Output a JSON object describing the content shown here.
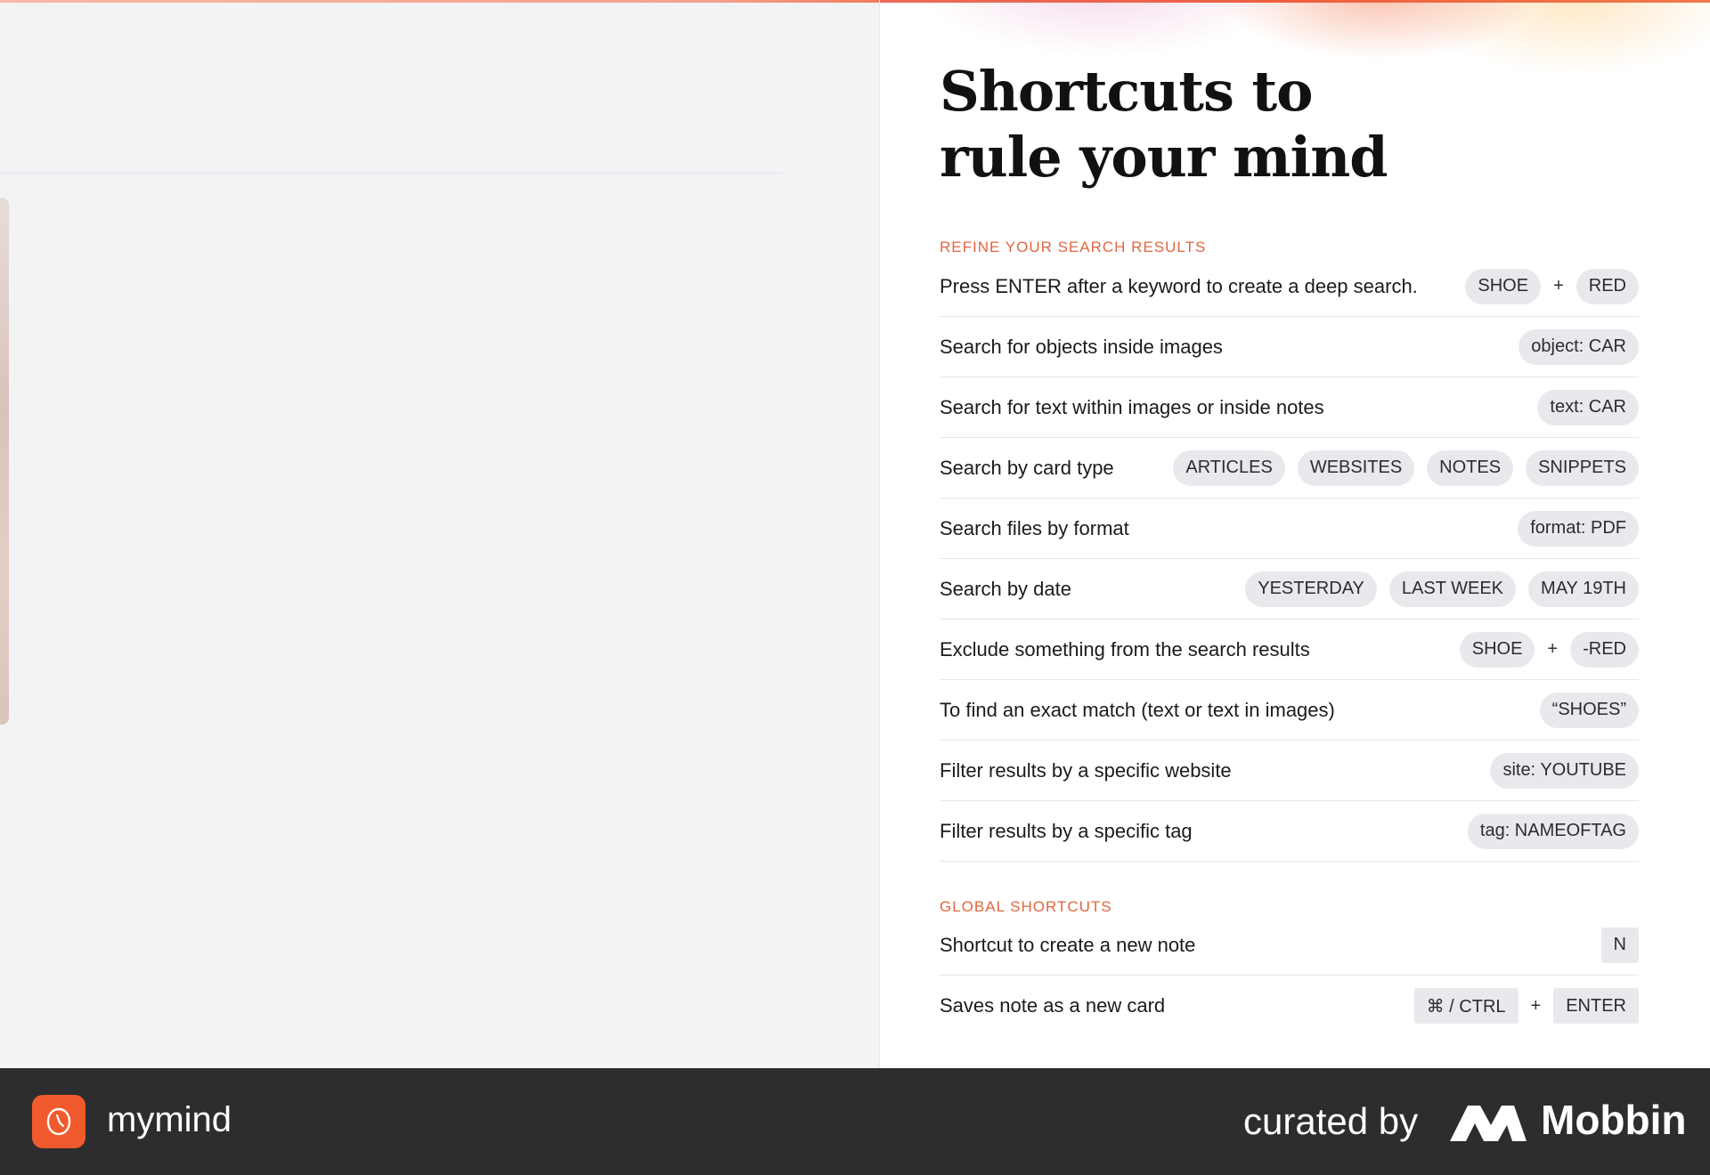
{
  "heading": {
    "line1": "Shortcuts to",
    "line2": "rule your mind"
  },
  "sections": {
    "refine": {
      "label": "REFINE YOUR SEARCH RESULTS",
      "rows": [
        {
          "label": "Press ENTER after a keyword to create a deep search.",
          "chip1": "SHOE",
          "plus": "+",
          "chip2": "RED"
        },
        {
          "label": "Search for objects inside images",
          "chip1": "object: CAR"
        },
        {
          "label": "Search for text within images or inside notes",
          "chip1": "text: CAR"
        },
        {
          "label": "Search by card type",
          "chip1": "ARTICLES",
          "chip2": "WEBSITES",
          "chip3": "NOTES",
          "chip4": "SNIPPETS"
        },
        {
          "label": "Search files by format",
          "chip1": "format: PDF"
        },
        {
          "label": "Search by date",
          "chip1": "YESTERDAY",
          "chip2": "LAST WEEK",
          "chip3": "MAY 19TH"
        },
        {
          "label": "Exclude something from the search results",
          "chip1": "SHOE",
          "plus": "+",
          "chip2": "-RED"
        },
        {
          "label": "To find an exact match (text or text in images)",
          "chip1": "“SHOES”"
        },
        {
          "label": "Filter results by a specific website",
          "chip1": "site: YOUTUBE"
        },
        {
          "label": "Filter results by a specific tag",
          "chip1": "tag: NAMEOFTAG"
        }
      ]
    },
    "global": {
      "label": "GLOBAL SHORTCUTS",
      "rows": [
        {
          "label": "Shortcut to create a new note",
          "key1": "N"
        },
        {
          "label": "Saves note as a new card",
          "key1": "⌘ / CTRL",
          "plus": "+",
          "key2": "ENTER"
        }
      ]
    }
  },
  "footer": {
    "brand": "mymind",
    "curated": "curated by",
    "mobbin": "Mobbin"
  },
  "colors": {
    "accent": "#e0663e",
    "logo": "#f15a2c",
    "footer_bg": "#2d2d2f"
  },
  "icons": {
    "logo": "mymind-logo-icon",
    "mobbin": "mobbin-logo-icon"
  }
}
